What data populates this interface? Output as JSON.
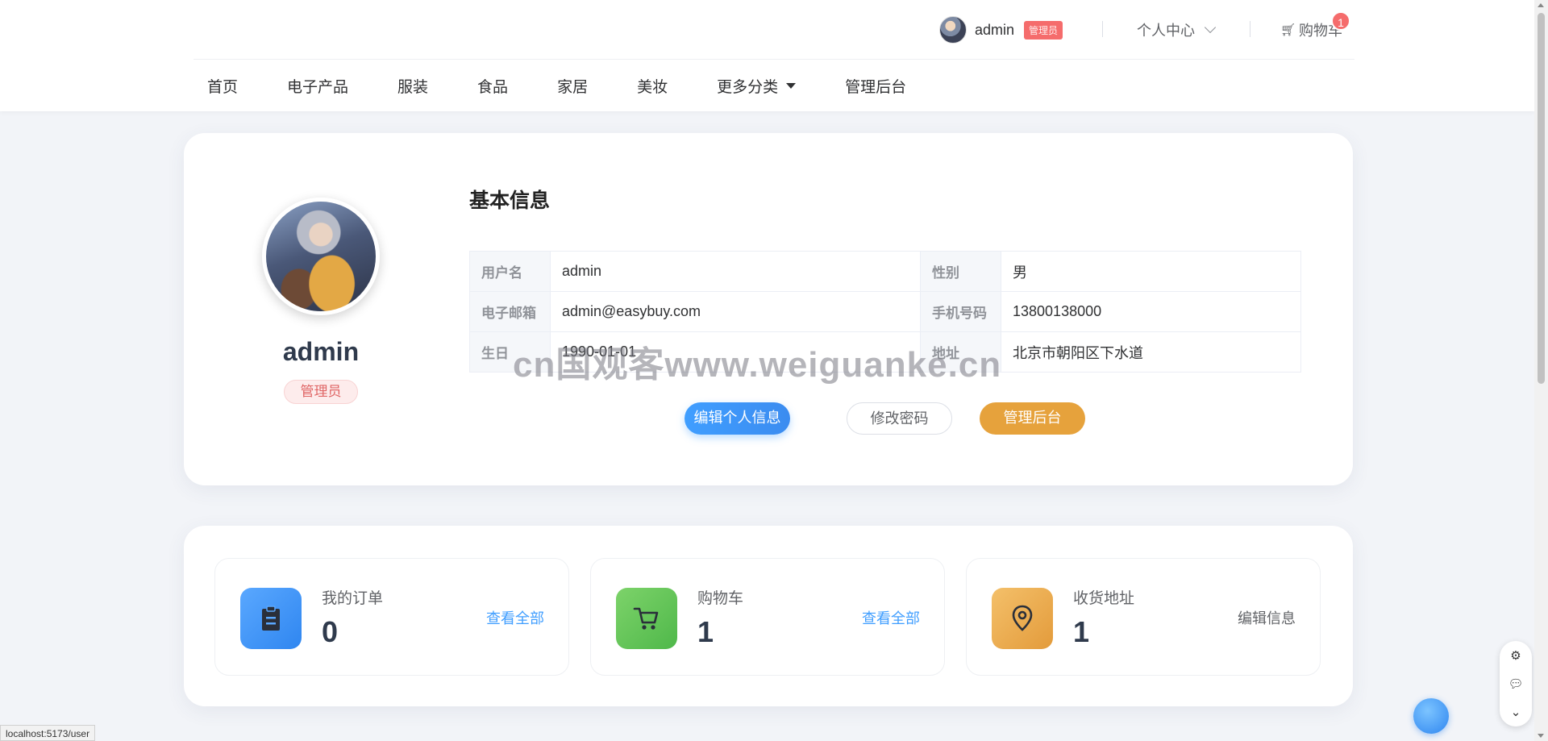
{
  "header": {
    "username": "admin",
    "role_badge": "管理员",
    "personal_center": "个人中心",
    "cart_label": "购物车",
    "cart_count": "1"
  },
  "nav": {
    "items": [
      {
        "label": "首页"
      },
      {
        "label": "电子产品"
      },
      {
        "label": "服装"
      },
      {
        "label": "食品"
      },
      {
        "label": "家居"
      },
      {
        "label": "美妆"
      },
      {
        "label": "更多分类"
      },
      {
        "label": "管理后台"
      }
    ]
  },
  "profile": {
    "name": "admin",
    "role": "管理员",
    "section_title": "基本信息",
    "fields": {
      "username_label": "用户名",
      "username_value": "admin",
      "gender_label": "性别",
      "gender_value": "男",
      "email_label": "电子邮箱",
      "email_value": "admin@easybuy.com",
      "phone_label": "手机号码",
      "phone_value": "13800138000",
      "birthday_label": "生日",
      "birthday_value": "1990-01-01",
      "address_label": "地址",
      "address_value": "北京市朝阳区下水道"
    },
    "buttons": {
      "edit": "编辑个人信息",
      "password": "修改密码",
      "admin": "管理后台"
    }
  },
  "stats": [
    {
      "label": "我的订单",
      "value": "0",
      "link": "查看全部",
      "icon": "clipboard-icon"
    },
    {
      "label": "购物车",
      "value": "1",
      "link": "查看全部",
      "icon": "cart-icon"
    },
    {
      "label": "收货地址",
      "value": "1",
      "link": "编辑信息",
      "icon": "location-icon"
    }
  ],
  "watermark": "cn国观客www.weiguanke.cn",
  "status_url": "localhost:5173/user",
  "colors": {
    "primary": "#409eff",
    "warning": "#e6a23c",
    "danger": "#f56c6c",
    "success": "#67c23a"
  }
}
